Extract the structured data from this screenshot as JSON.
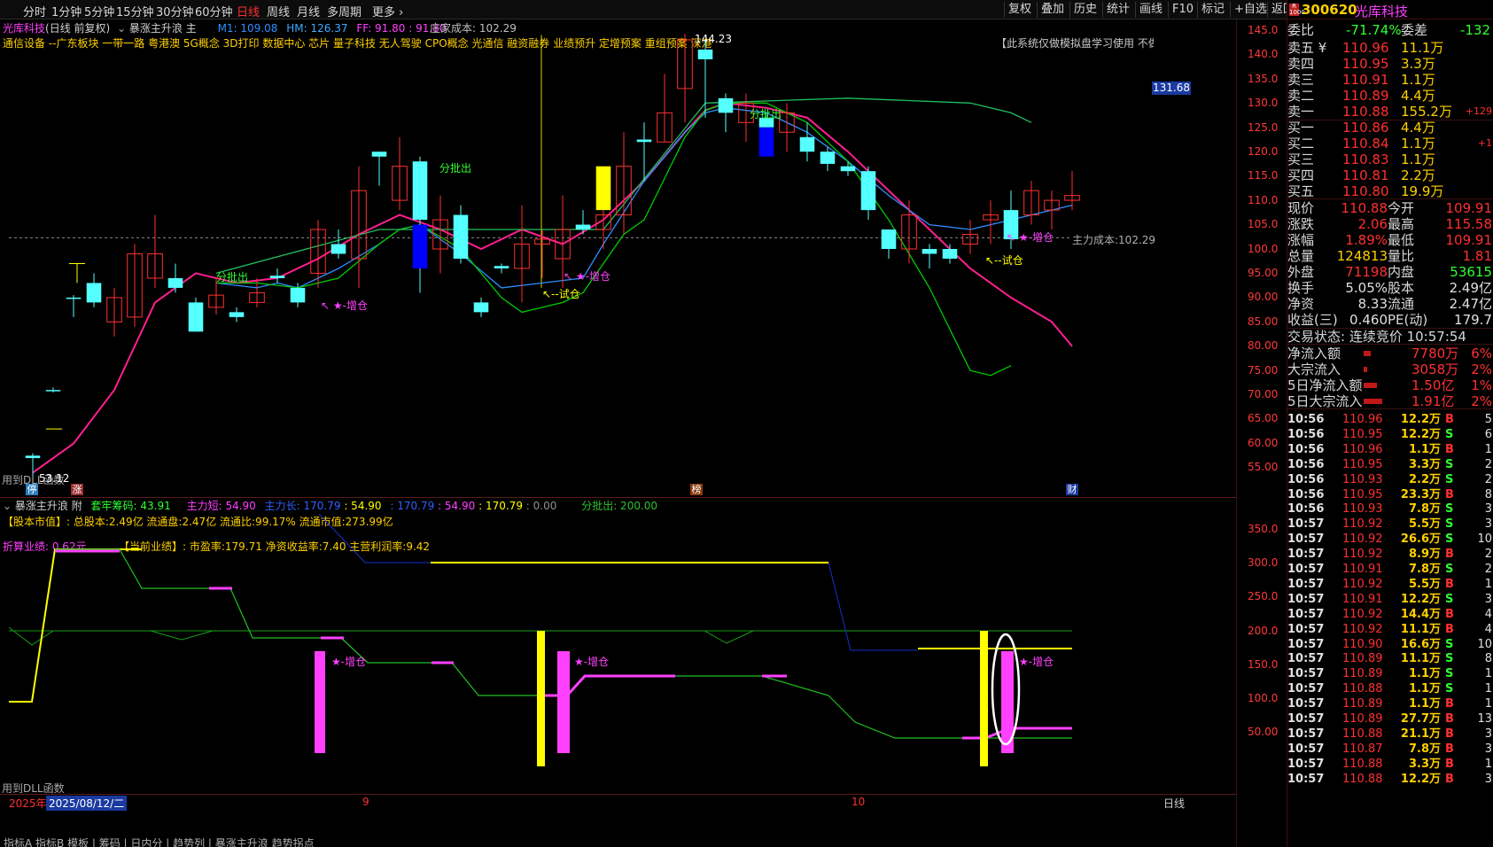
{
  "topbar": {
    "tabs": [
      "分时",
      "1分钟",
      "5分钟",
      "15分钟",
      "30分钟",
      "60分钟",
      "日线",
      "周线",
      "月线",
      "多周期",
      "更多 ›"
    ],
    "active_tab": "日线",
    "right_buttons": [
      "复权",
      "叠加",
      "历史",
      "统计",
      "画线",
      "F10",
      "标记",
      "+自选",
      "返回"
    ]
  },
  "header": {
    "stock_name": "光库科技",
    "mode": "(日线 前复权)",
    "indicator_main": "暴涨主升浪 主",
    "m1": "M1: 109.08",
    "hm": "HM: 126.37",
    "ff": "FF: 91.80 : 91.80",
    "dealer_cost": "庄家成本: 102.29",
    "concepts": "通信设备 --广东板块 一带一路 粤港澳 5G概念 3D打印 数据中心 芯片 量子科技 无人驾驶 CPO概念 光通信 融资融券 业绩预升 定增预案 重组预案 深港通SZ 百元股",
    "notice": "【此系统仅做模拟盘学习使用 不做估"
  },
  "main_chart": {
    "y_ticks": [
      "145.0",
      "140.0",
      "135.0",
      "130.0",
      "125.0",
      "120.0",
      "115.0",
      "110.0",
      "105.0",
      "100.0",
      "95.00",
      "90.00",
      "85.00",
      "80.00",
      "75.00",
      "70.00",
      "65.00",
      "60.00",
      "55.00"
    ],
    "price_tag": "131.68",
    "high_label": "144.23",
    "low_label": "53.12",
    "main_cost_label": "主力成本:102.29",
    "annotations": {
      "fen_pi_chu": "分批出",
      "zeng_cang": "★-增仓",
      "shi_cang": "↖--试仓",
      "zeng_cang_arrow": "↖ ★-增仓"
    },
    "dll_text": "用到DLL函数",
    "badges": {
      "ting": "停",
      "zhang": "涨",
      "bang": "榜",
      "cai": "财"
    }
  },
  "sub_chart": {
    "title": "暴涨主升浪 附",
    "taolao": "套牢筹码: 43.91",
    "zhuli_short": "主力短: 54.90",
    "zhuli_long": "主力长: 170.79",
    "v1": ": 54.90",
    "v2": ": 170.79",
    "v3": ": 54.90",
    "v4": ": 170.79",
    "v5": ": 0.00",
    "fen_pi": "分批出: 200.00",
    "equity": "【股本市值】: 总股本:2.49亿 流通盘:2.47亿 流通比:99.17% 流通市值:273.99亿",
    "perf_label": "折算业绩: 0.62元",
    "perf_now": "【当前业绩】: 市盈率:179.71 净资收益率:7.40 主营利润率:9.42",
    "y_ticks": [
      "350.0",
      "300.0",
      "250.0",
      "200.0",
      "150.0",
      "100.0",
      "50.00"
    ],
    "dll_text": "用到DLL函数",
    "zeng_cang": "★-增仓"
  },
  "bottom": {
    "year": "2025年",
    "date": "2025/08/12/二",
    "m9": "9",
    "m10": "10",
    "period": "日线",
    "tabs_text": "指标A 指标B 模板 | 筹码 | 日内分 | 趋势列 | 暴涨主升浪 趋势拐点"
  },
  "quote": {
    "code": "300620",
    "name": "光库科技",
    "weibi_label": "委比",
    "weibi": "-71.74%",
    "weicha_label": "委差",
    "weicha": "-132",
    "asks": [
      [
        "卖五 ¥",
        "110.96",
        "11.1万",
        ""
      ],
      [
        "卖四",
        "110.95",
        "3.3万",
        ""
      ],
      [
        "卖三",
        "110.91",
        "1.1万",
        ""
      ],
      [
        "卖二",
        "110.89",
        "4.4万",
        ""
      ],
      [
        "卖一",
        "110.88",
        "155.2万",
        "+129"
      ]
    ],
    "bids": [
      [
        "买一",
        "110.86",
        "4.4万",
        ""
      ],
      [
        "买二",
        "110.84",
        "1.1万",
        "+1"
      ],
      [
        "买三",
        "110.83",
        "1.1万",
        ""
      ],
      [
        "买四",
        "110.81",
        "2.2万",
        ""
      ],
      [
        "买五",
        "110.80",
        "19.9万",
        ""
      ]
    ],
    "stats": [
      [
        "现价",
        "110.88",
        "今开",
        "109.91"
      ],
      [
        "涨跌",
        "2.06",
        "最高",
        "115.58"
      ],
      [
        "涨幅",
        "1.89%",
        "最低",
        "109.91"
      ],
      [
        "总量",
        "124813",
        "量比",
        "1.81"
      ],
      [
        "外盘",
        "71198",
        "内盘",
        "53615"
      ],
      [
        "换手",
        "5.05%",
        "股本",
        "2.49亿"
      ],
      [
        "净资",
        "8.33",
        "流通",
        "2.47亿"
      ],
      [
        "收益(三)",
        "0.460",
        "PE(动)",
        "179.7"
      ]
    ],
    "trade_state": "交易状态: 连续竞价 10:57:54",
    "flows": [
      [
        "净流入额",
        "7780万",
        "6%"
      ],
      [
        "大宗流入",
        "3058万",
        "2%"
      ],
      [
        "5日净流入额",
        "1.50亿",
        "1%"
      ],
      [
        "5日大宗流入",
        "1.91亿",
        "2%"
      ]
    ],
    "flow_fill": [
      0.28,
      0.12,
      0.5,
      0.7
    ]
  },
  "ticks": [
    [
      "10:56",
      "110.96",
      "12.2万",
      "B",
      "5"
    ],
    [
      "10:56",
      "110.95",
      "12.2万",
      "S",
      "6"
    ],
    [
      "10:56",
      "110.96",
      "1.1万",
      "B",
      "1"
    ],
    [
      "10:56",
      "110.95",
      "3.3万",
      "S",
      "2"
    ],
    [
      "10:56",
      "110.93",
      "2.2万",
      "S",
      "2"
    ],
    [
      "10:56",
      "110.95",
      "23.3万",
      "B",
      "8"
    ],
    [
      "10:56",
      "110.93",
      "7.8万",
      "S",
      "3"
    ],
    [
      "10:57",
      "110.92",
      "5.5万",
      "S",
      "3"
    ],
    [
      "10:57",
      "110.92",
      "26.6万",
      "S",
      "10"
    ],
    [
      "10:57",
      "110.92",
      "8.9万",
      "B",
      "2"
    ],
    [
      "10:57",
      "110.91",
      "7.8万",
      "S",
      "2"
    ],
    [
      "10:57",
      "110.92",
      "5.5万",
      "B",
      "1"
    ],
    [
      "10:57",
      "110.91",
      "12.2万",
      "S",
      "3"
    ],
    [
      "10:57",
      "110.92",
      "14.4万",
      "B",
      "4"
    ],
    [
      "10:57",
      "110.92",
      "11.1万",
      "B",
      "4"
    ],
    [
      "10:57",
      "110.90",
      "16.6万",
      "S",
      "10"
    ],
    [
      "10:57",
      "110.89",
      "11.1万",
      "S",
      "8"
    ],
    [
      "10:57",
      "110.89",
      "1.1万",
      "S",
      "1"
    ],
    [
      "10:57",
      "110.88",
      "1.1万",
      "S",
      "1"
    ],
    [
      "10:57",
      "110.89",
      "1.1万",
      "B",
      "1"
    ],
    [
      "10:57",
      "110.89",
      "27.7万",
      "B",
      "13"
    ],
    [
      "10:57",
      "110.88",
      "21.1万",
      "B",
      "3"
    ],
    [
      "10:57",
      "110.87",
      "7.8万",
      "B",
      "3"
    ],
    [
      "10:57",
      "110.88",
      "3.3万",
      "B",
      "1"
    ],
    [
      "10:57",
      "110.88",
      "12.2万",
      "B",
      "3"
    ]
  ],
  "chart_data": {
    "type": "candlestick",
    "ylim": [
      53,
      146
    ],
    "candles": [
      [
        57,
        57.5,
        53.1,
        58,
        0
      ],
      [
        71,
        71,
        70.5,
        71.5,
        0
      ],
      [
        90,
        90,
        86,
        90.5,
        0
      ],
      [
        93,
        89,
        88,
        95,
        0
      ],
      [
        85,
        90,
        82,
        92,
        1
      ],
      [
        99,
        86,
        84,
        101,
        1
      ],
      [
        94,
        99,
        92,
        107,
        1
      ],
      [
        92,
        94,
        91,
        97,
        0
      ],
      [
        89,
        83,
        83,
        90,
        0
      ],
      [
        88,
        90.5,
        86.5,
        94,
        1
      ],
      [
        86,
        87,
        85,
        88,
        0
      ],
      [
        89,
        91,
        88,
        94,
        1
      ],
      [
        94,
        94.5,
        93,
        96,
        0
      ],
      [
        92,
        89,
        88,
        93,
        0
      ],
      [
        95,
        104,
        92,
        106,
        1
      ],
      [
        101,
        99,
        98,
        104,
        0
      ],
      [
        98,
        112,
        92,
        117,
        1
      ],
      [
        120,
        119,
        113,
        120,
        0
      ],
      [
        110,
        117,
        108,
        123,
        1
      ],
      [
        118,
        106,
        91,
        119,
        0
      ],
      [
        100,
        106,
        95,
        111,
        1
      ],
      [
        107,
        98,
        97,
        109,
        0
      ],
      [
        89,
        87,
        86,
        90,
        0
      ],
      [
        96,
        96.5,
        95,
        97,
        0
      ],
      [
        96,
        101,
        89,
        109,
        1
      ],
      [
        101,
        102,
        94,
        104,
        1
      ],
      [
        98,
        104,
        92,
        111,
        1
      ],
      [
        104,
        105,
        103,
        108,
        0
      ],
      [
        104,
        107,
        100,
        109,
        1
      ],
      [
        107,
        117,
        103,
        124,
        1
      ],
      [
        122,
        122.5,
        114,
        126,
        0
      ],
      [
        122,
        128,
        122,
        136,
        1
      ],
      [
        133,
        143,
        126,
        144.2,
        1
      ],
      [
        141,
        139,
        127,
        143,
        0
      ],
      [
        131,
        128,
        124,
        132,
        0
      ],
      [
        126,
        130,
        122,
        132,
        1
      ],
      [
        127,
        125,
        122,
        128,
        0
      ],
      [
        124,
        128,
        120,
        130,
        1
      ],
      [
        123,
        120,
        118,
        126,
        0
      ],
      [
        120,
        117.5,
        116,
        121,
        0
      ],
      [
        116,
        117,
        115,
        118,
        0
      ],
      [
        116,
        108,
        106,
        117,
        0
      ],
      [
        104,
        100,
        98,
        104,
        0
      ],
      [
        100,
        107,
        97,
        110,
        1
      ],
      [
        100,
        99,
        96,
        101,
        0
      ],
      [
        100,
        98,
        97,
        101,
        0
      ],
      [
        101,
        103,
        99,
        106,
        1
      ],
      [
        106,
        107,
        101,
        110,
        1
      ],
      [
        108,
        102,
        100,
        112,
        0
      ],
      [
        107,
        112,
        105,
        114,
        1
      ],
      [
        108,
        110,
        104,
        112,
        1
      ],
      [
        110,
        111,
        108,
        116,
        1
      ]
    ],
    "series": [
      {
        "values": [
          [
            0,
            54
          ],
          [
            2,
            60
          ],
          [
            4,
            71
          ],
          [
            6,
            89
          ],
          [
            8,
            95
          ],
          [
            10,
            93
          ],
          [
            12,
            94
          ],
          [
            14,
            98
          ],
          [
            16,
            103
          ],
          [
            18,
            107
          ],
          [
            20,
            104
          ],
          [
            22,
            100
          ],
          [
            24,
            104
          ],
          [
            26,
            101
          ],
          [
            28,
            106
          ],
          [
            30,
            114
          ],
          [
            32,
            124
          ],
          [
            33,
            128.5
          ],
          [
            34,
            130
          ],
          [
            36,
            129
          ],
          [
            38,
            127
          ],
          [
            40,
            120
          ],
          [
            42,
            112
          ],
          [
            44,
            104
          ],
          [
            46,
            96
          ],
          [
            48,
            90
          ],
          [
            50,
            85
          ],
          [
            51,
            80
          ]
        ]
      },
      {
        "values": [
          [
            9,
            93
          ],
          [
            11,
            92
          ],
          [
            12,
            93
          ],
          [
            13,
            92
          ],
          [
            15,
            96
          ],
          [
            17,
            101
          ],
          [
            18,
            104
          ],
          [
            19,
            105
          ],
          [
            21,
            99
          ],
          [
            23,
            92
          ],
          [
            25,
            93
          ],
          [
            27,
            94
          ],
          [
            28,
            101
          ],
          [
            30,
            114
          ],
          [
            32,
            124
          ],
          [
            33,
            128
          ],
          [
            34,
            129
          ],
          [
            36,
            128
          ],
          [
            38,
            124
          ],
          [
            40,
            118
          ],
          [
            42,
            111
          ],
          [
            44,
            105
          ],
          [
            46,
            104
          ],
          [
            47,
            105
          ],
          [
            49,
            107
          ],
          [
            51,
            109
          ]
        ]
      },
      {
        "values": [
          [
            9,
            93
          ],
          [
            11,
            93
          ],
          [
            13,
            92
          ],
          [
            15,
            94
          ],
          [
            17,
            101
          ],
          [
            18,
            104
          ],
          [
            19,
            105
          ],
          [
            21,
            100
          ],
          [
            23,
            90
          ],
          [
            24,
            87
          ],
          [
            26,
            89
          ],
          [
            27,
            91
          ],
          [
            29,
            103
          ],
          [
            30,
            106
          ],
          [
            32,
            123
          ],
          [
            33,
            128.5
          ],
          [
            34,
            130
          ],
          [
            36,
            130
          ],
          [
            38,
            126
          ],
          [
            40,
            118
          ],
          [
            42,
            106
          ],
          [
            44,
            92
          ],
          [
            46,
            75
          ],
          [
            47,
            74
          ],
          [
            48,
            76
          ]
        ]
      },
      {
        "values": [
          [
            9,
            95
          ],
          [
            17,
            104
          ],
          [
            28,
            104
          ],
          [
            33,
            130
          ],
          [
            40,
            131
          ],
          [
            46,
            130
          ],
          [
            48,
            128
          ],
          [
            49,
            126
          ]
        ]
      }
    ]
  },
  "colors": {
    "up": "#ff3030",
    "down_fill": "#54ffff",
    "down_blue": "#0000ff",
    "pink": "#ff1f8f",
    "magenta": "#ff40ff",
    "yellow": "#ffff00",
    "green": "#00cc00",
    "blue": "#2f8fff"
  }
}
